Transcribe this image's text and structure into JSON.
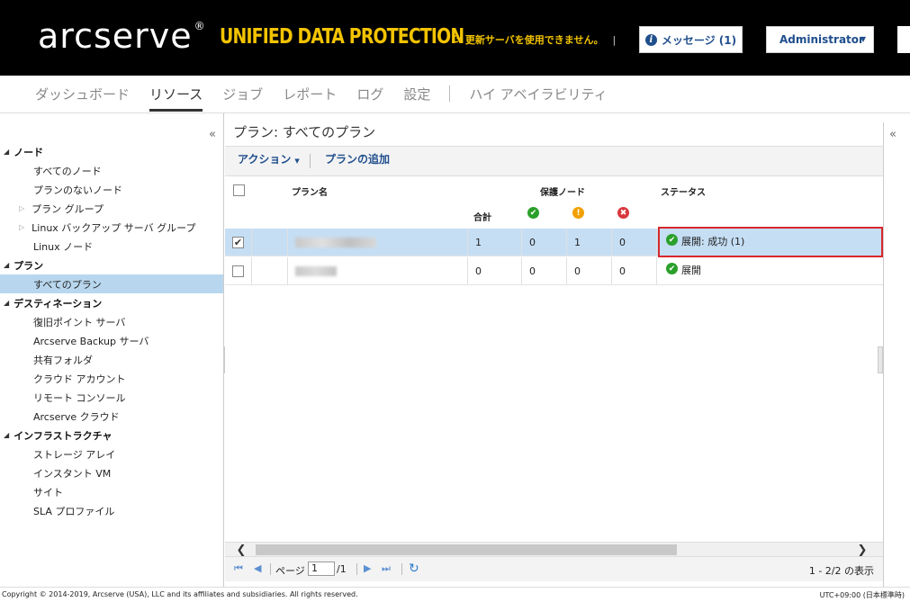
{
  "header": {
    "logo": "arcserve",
    "logo_reg": "®",
    "product": "UNIFIED DATA PROTECTION",
    "update_warning": "更新サーバを使用できません。",
    "messages_label": "メッセージ (1)",
    "user_label": "Administrator",
    "colors": {
      "bg": "#000000",
      "accent": "#f2c300",
      "link": "#1f4e8c"
    }
  },
  "nav": {
    "items": [
      "ダッシュボード",
      "リソース",
      "ジョブ",
      "レポート",
      "ログ",
      "設定"
    ],
    "active": "リソース",
    "extra": "ハイ アベイラビリティ"
  },
  "tree": {
    "node": {
      "label": "ノード",
      "items": [
        "すべてのノード",
        "プランのないノード",
        "プラン グループ",
        "Linux バックアップ サーバ グループ",
        "Linux ノード"
      ]
    },
    "plan": {
      "label": "プラン",
      "items": [
        "すべてのプラン"
      ]
    },
    "destination": {
      "label": "デスティネーション",
      "items": [
        "復旧ポイント サーバ",
        "Arcserve Backup サーバ",
        "共有フォルダ",
        "クラウド アカウント",
        "リモート コンソール",
        "Arcserve クラウド"
      ]
    },
    "infrastructure": {
      "label": "インフラストラクチャ",
      "items": [
        "ストレージ アレイ",
        "インスタント VM",
        "サイト",
        "SLA プロファイル"
      ]
    }
  },
  "main": {
    "title": "プラン: すべてのプラン",
    "toolbar": {
      "action": "アクション",
      "add_plan": "プランの追加"
    },
    "columns": {
      "name": "プラン名",
      "protected_nodes": "保護ノード",
      "status": "ステータス",
      "total": "合計"
    },
    "header_icons": {
      "ok": "✔",
      "warn": "!",
      "err": "✖"
    },
    "rows": [
      {
        "checked": "✔",
        "total": "1",
        "ok": "0",
        "warn": "1",
        "err": "0",
        "status": "展開: 成功 (1)"
      },
      {
        "checked": "",
        "total": "0",
        "ok": "0",
        "warn": "0",
        "err": "0",
        "status": "展開"
      }
    ]
  },
  "scroll": {
    "left": "❮",
    "right": "❯"
  },
  "pager": {
    "first": "⏮",
    "prev": "◀",
    "page_label": "ページ",
    "page": "1",
    "of": "/1",
    "next": "▶",
    "last": "⏭",
    "refresh": "↻",
    "count": "1 - 2/2 の表示"
  },
  "panel": {
    "collapse_left": "«",
    "collapse_right": "«",
    "splitter": "◂"
  },
  "footer": {
    "copyright": "Copyright © 2014-2019, Arcserve (USA), LLC and its affiliates and subsidiaries. All rights reserved.",
    "timezone": "UTC+09:00 (日本標準時)"
  }
}
